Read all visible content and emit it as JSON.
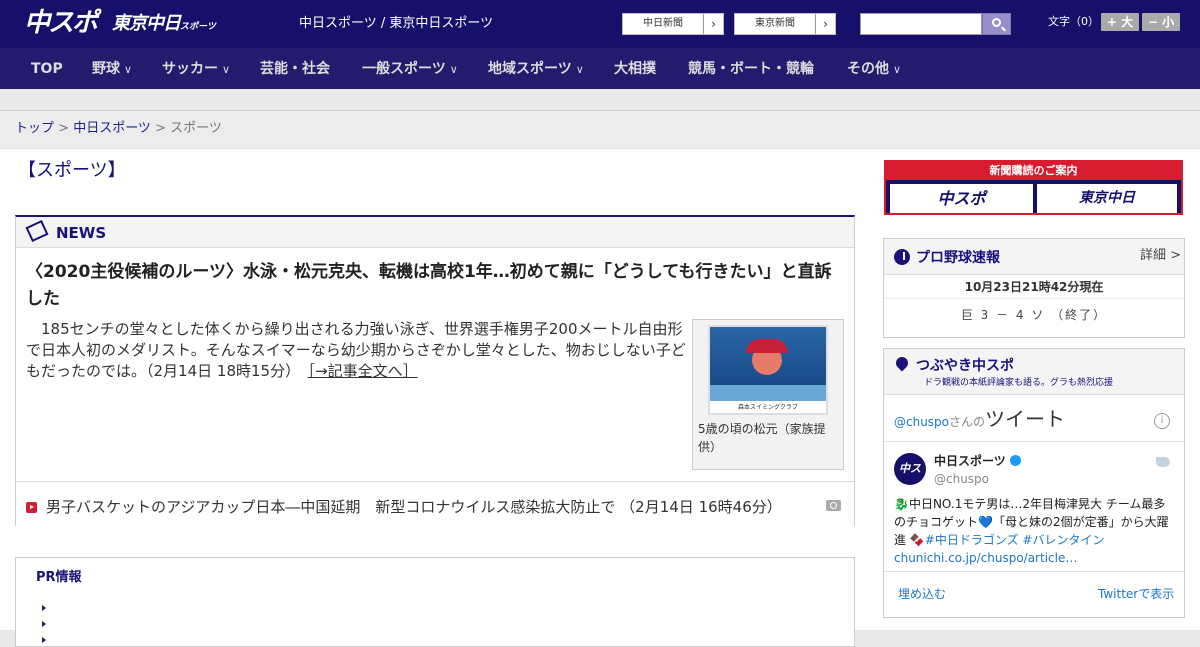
{
  "header": {
    "logo_chuspo": "中スポ",
    "logo_tokyo": "東京中日",
    "logo_tokyo_sub": "スポーツ",
    "site_links": "中日スポーツ / 東京中日スポーツ",
    "btn_chunichi": "中日新聞",
    "btn_tokyo": "東京新聞",
    "search_placeholder": "",
    "font_size_label": "文字（0）",
    "font_bigger": "+ 大",
    "font_smaller": "− 小"
  },
  "nav": {
    "items": [
      {
        "label": "TOP",
        "dropdown": false
      },
      {
        "label": "野球",
        "dropdown": true
      },
      {
        "label": "サッカー",
        "dropdown": true
      },
      {
        "label": "芸能・社会",
        "dropdown": false
      },
      {
        "label": "一般スポーツ",
        "dropdown": true
      },
      {
        "label": "地域スポーツ",
        "dropdown": true
      },
      {
        "label": "大相撲",
        "dropdown": false
      },
      {
        "label": "競馬・ボート・競輪",
        "dropdown": false
      },
      {
        "label": "その他",
        "dropdown": true
      }
    ]
  },
  "breadcrumb": {
    "home": "トップ",
    "sep": " > ",
    "section": "中日スポーツ",
    "current": "スポーツ"
  },
  "page_title": "【スポーツ】",
  "news": {
    "section_label": "NEWS",
    "headline": "〈2020主役候補のルーツ〉水泳・松元克央、転機は高校1年…初めて親に「どうしても行きたい」と直訴した",
    "lead": "185センチの堂々とした体くから繰り出される力強い泳ぎ、世界選手権男子200メートル自由形で日本人初のメダリスト。そんなスイマーなら幼少期からさぞかし堂々とした、物おじしない子どもだったのでは。（2月14日 18時15分）",
    "read_more": "［→記事全文へ］",
    "photo_caption": "5歳の頃の松元（家族提供）",
    "photo_band_text": "森本スイミングクラブ",
    "sub_article": "男子バスケットのアジアカップ日本―中国延期　新型コロナウイルス感染拡大防止で （2月14日 16時46分）"
  },
  "pr": {
    "title": "PR情報"
  },
  "sidebar": {
    "ad": {
      "top": "新聞購読のご案内",
      "chuspo": "中スポ",
      "tokyo": "東京中日"
    },
    "baseball": {
      "title": "プロ野球速報",
      "detail": "詳細 >",
      "timestamp": "10月23日21時42分現在",
      "score": "巨 3 － 4 ソ （終了）"
    },
    "tweets": {
      "title": "つぶやき中スポ",
      "subtitle": "ドラ観戦の本紙評論家も語る。グラも熱烈応援",
      "handle_prefix": "@chuspo",
      "handle_suffix": "さんの",
      "tweet_label": "ツイート",
      "info_icon": "i",
      "avatar_text": "中スポ",
      "account_name": "中日スポーツ",
      "account_handle": "@chuspo",
      "text_a": "🐉中日NO.1モテ男は…2年目梅津晃大 チーム最多のチョコゲット💙「母と妹の2個が定番」から大躍進 🍫",
      "text_b": "#中日ドラゴンズ #バレンタイン",
      "text_c": "chunichi.co.jp/chuspo/article…",
      "embed": "埋め込む",
      "view_on_twitter": "Twitterで表示"
    }
  }
}
